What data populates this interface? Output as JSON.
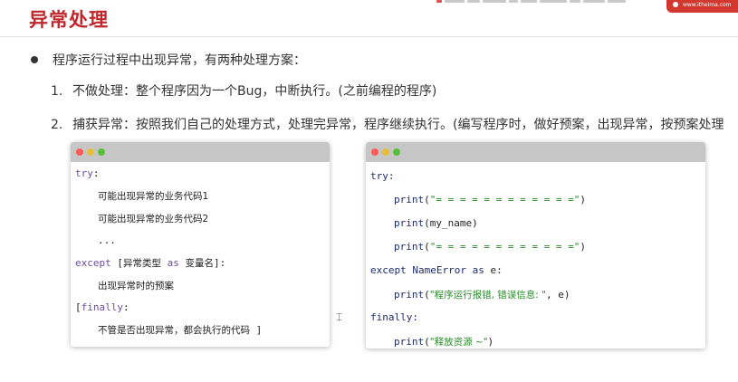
{
  "title": "异常处理",
  "bullet": "程序运行过程中出现异常，有两种处理方案：",
  "items": [
    {
      "num": "1.",
      "text": "不做处理：整个程序因为一个Bug，中断执行。(之前编程的程序)"
    },
    {
      "num": "2.",
      "text": "捕获异常：按照我们自己的处理方式，处理完异常，程序继续执行。(编写程序时，做好预案，出现异常，按预案处理"
    }
  ],
  "logo": {
    "text": "www.itheima.com"
  },
  "left_code": {
    "try": "try",
    "colon": ":",
    "code1": "可能出现异常的业务代码1",
    "code2": "可能出现异常的业务代码2",
    "ellipsis": "...",
    "except_kw": "except",
    "bracket_open": " [",
    "exc_type": "异常类型",
    "as_kw": " as ",
    "var_name": "变量名",
    "bracket_close_colon": "]:",
    "handler": "出现异常时的预案",
    "finally_open": "[",
    "finally_kw": "finally",
    "finally_colon": ":",
    "final_code": "不管是否出现异常，都会执行的代码",
    "final_close": " ]"
  },
  "right_code": {
    "try": "try:",
    "print_fn": "print",
    "paren_open": "(",
    "paren_close": ")",
    "sep_str": "\"= = = = = = = = = = = =\"",
    "my_name": "my_name",
    "except_kw": "except",
    "name_error": " NameError",
    "as_kw": " as ",
    "e_colon": "e:",
    "err_str": "\"程序运行报错, 错误信息: \"",
    "comma_e": ", e",
    "finally": "finally:",
    "release_str": "\"释放资源 ~\""
  }
}
